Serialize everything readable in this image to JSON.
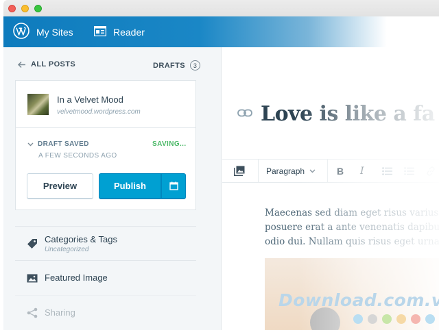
{
  "topbar": {
    "my_sites": "My Sites",
    "reader": "Reader"
  },
  "sidebar": {
    "all_posts": "ALL POSTS",
    "drafts": "DRAFTS",
    "drafts_count": "3",
    "site": {
      "name": "In a Velvet Mood",
      "url": "velvetmood.wordpress.com"
    },
    "status": {
      "draft_saved": "DRAFT SAVED",
      "saving": "SAVING...",
      "time": "A FEW SECONDS AGO"
    },
    "buttons": {
      "preview": "Preview",
      "publish": "Publish"
    },
    "sections": [
      {
        "title": "Categories & Tags",
        "subtitle": "Uncategorized",
        "icon": "tag-icon"
      },
      {
        "title": "Featured Image",
        "icon": "image-icon"
      },
      {
        "title": "Sharing",
        "icon": "share-icon"
      }
    ]
  },
  "editor": {
    "title": "Love is like a fa",
    "toolbar": {
      "paragraph": "Paragraph"
    },
    "body_lines": [
      "Maecenas sed diam eget risus varius",
      "posuere erat a ante venenatis dapibus",
      "odio dui. Nullam quis risus eget urna"
    ]
  },
  "watermark": {
    "text": "Download.com.vn",
    "dot_colors": [
      "#b9def2",
      "#d6d6d6",
      "#c8e6a8",
      "#f6d9a6",
      "#f5b6b0",
      "#b9def2"
    ]
  },
  "colors": {
    "accent": "#00a0d2",
    "topbar": "#0e7bbd",
    "saving": "#4ab866"
  }
}
